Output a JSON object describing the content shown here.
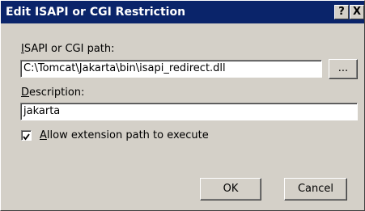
{
  "window": {
    "title": "Edit ISAPI or CGI Restriction",
    "help_glyph": "?",
    "close_glyph": "X"
  },
  "path": {
    "label_accel": "I",
    "label_rest": "SAPI or CGI path:",
    "value": "C:\\Tomcat\\Jakarta\\bin\\isapi_redirect.dll",
    "browse_label": "..."
  },
  "description": {
    "label_accel": "D",
    "label_rest": "escription:",
    "value": "jakarta"
  },
  "allow": {
    "checked": true,
    "label_accel": "A",
    "label_rest": "llow extension path to execute"
  },
  "buttons": {
    "ok": "OK",
    "cancel": "Cancel"
  },
  "colors": {
    "title_bar": "#0a246a",
    "face": "#d4d0c8"
  }
}
